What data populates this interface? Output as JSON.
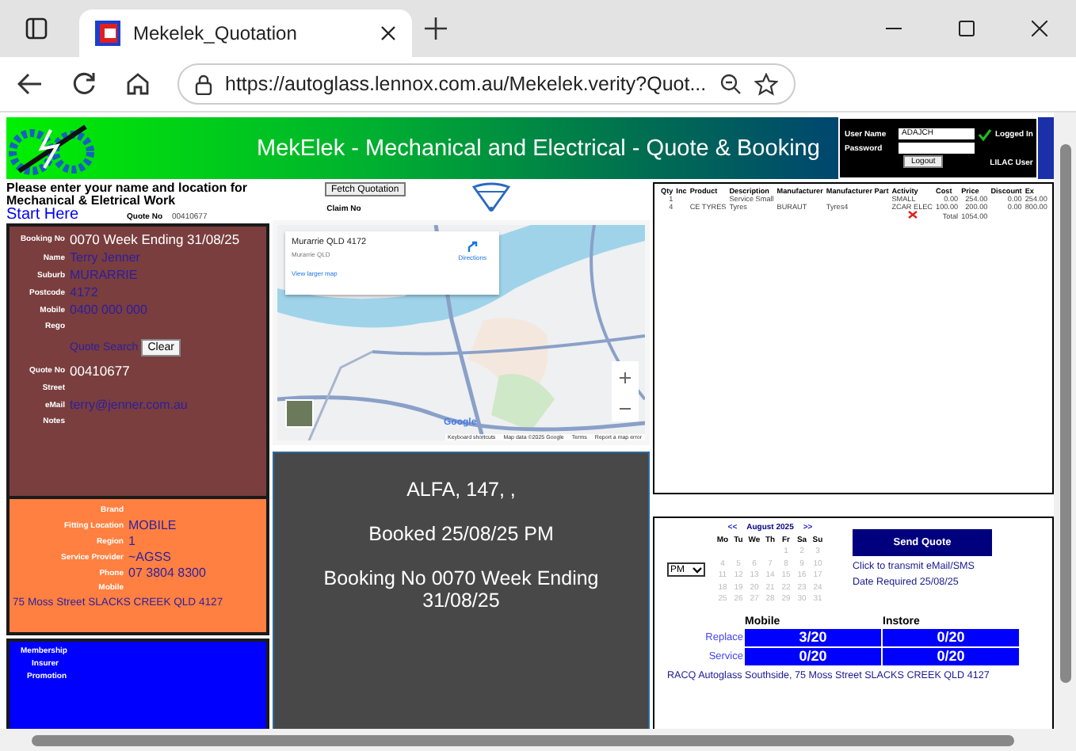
{
  "browser": {
    "tab_title": "Mekelek_Quotation",
    "url": "https://autoglass.lennox.com.au/Mekelek.verity?Quot..."
  },
  "header": {
    "title": "MekElek - Mechanical and Electrical - Quote & Booking",
    "login": {
      "user_label": "User Name",
      "user_value": "ADAJCH",
      "password_label": "Password",
      "logout": "Logout",
      "status": "Logged In",
      "role": "LILAC User"
    }
  },
  "intro": {
    "text": "Please enter your name and location for Mechanical & Eletrical Work",
    "start_link": "Start Here",
    "quote_label": "Quote No",
    "quote_value": "00410677"
  },
  "booking_fields": [
    {
      "kind": "heading",
      "label": "Booking No",
      "value": "0070 Week Ending 31/08/25"
    },
    {
      "kind": "field",
      "label": "Name",
      "value": "Terry Jenner"
    },
    {
      "kind": "field",
      "label": "Suburb",
      "value": "MURARRIE"
    },
    {
      "kind": "field",
      "label": "Postcode",
      "value": "4172"
    },
    {
      "kind": "field",
      "label": "Mobile",
      "value": "0400 000 000"
    },
    {
      "kind": "field",
      "label": "Rego"
    },
    {
      "kind": "search",
      "link": "Quote Search",
      "button": "Clear"
    },
    {
      "kind": "heading",
      "label": "Quote No",
      "value": "00410677"
    },
    {
      "kind": "field",
      "label": "Street"
    },
    {
      "kind": "field",
      "label": "eMail",
      "value": "terry@jenner.com.au"
    },
    {
      "kind": "field",
      "label": "Notes"
    }
  ],
  "provider_fields": [
    {
      "label": "Brand"
    },
    {
      "label": "Fitting Location",
      "value": "MOBILE"
    },
    {
      "label": "Region",
      "value": "1"
    },
    {
      "label": "Service Provider",
      "value": "~AGSS"
    },
    {
      "label": "Phone",
      "value": "07 3804 8300"
    },
    {
      "label": "Mobile"
    }
  ],
  "provider_address": "75 Moss Street SLACKS CREEK QLD 4127",
  "extra_fields": [
    "Membership",
    "Insurer",
    "Promotion"
  ],
  "fetch_button": "Fetch Quotation",
  "claim_label": "Claim No",
  "map": {
    "place": "Murarrie QLD 4172",
    "subtitle": "Murarrie QLD",
    "directions": "Directions",
    "larger": "View larger map",
    "logo": "Google",
    "footer": [
      "Keyboard shortcuts",
      "Map data ©2025 Google",
      "Terms",
      "Report a map error"
    ]
  },
  "summary": [
    "ALFA, 147, ,",
    "Booked 25/08/25 PM",
    "Booking No 0070 Week Ending 31/08/25"
  ],
  "quote_table": {
    "columns": [
      {
        "kind": "number",
        "label": "Qty"
      },
      {
        "kind": "text",
        "label": "Inc"
      },
      {
        "kind": "text",
        "label": "Product"
      },
      {
        "kind": "text",
        "label": "Description"
      },
      {
        "kind": "text",
        "label": "Manufacturer"
      },
      {
        "kind": "text",
        "label": "Manufacturer Part"
      },
      {
        "kind": "text",
        "label": "Activity"
      },
      {
        "kind": "number",
        "label": "Cost"
      },
      {
        "kind": "number",
        "label": "Price"
      },
      {
        "kind": "number",
        "label": "Discount"
      },
      {
        "kind": "number",
        "label": "Ex"
      }
    ],
    "rows": [
      [
        "1",
        null,
        null,
        "Service Small",
        null,
        null,
        "SMALL",
        "0.00",
        "254.00",
        "0.00",
        "254.00"
      ],
      [
        "4",
        null,
        "CE TYRES",
        "Tyres",
        "BURAUT",
        "Tyres4",
        "ZCAR ELEC",
        "100.00",
        "200.00",
        "0.00",
        "800.00"
      ]
    ],
    "total_label": "Total",
    "total_value": "1054.00"
  },
  "calendar": {
    "prev": "<<",
    "month": "August 2025",
    "next": ">>",
    "weekdays": [
      "Mo",
      "Tu",
      "We",
      "Th",
      "Fr",
      "Sa",
      "Su"
    ],
    "weeks": [
      [
        "1",
        "2",
        "3"
      ],
      [
        "4",
        "5",
        "6",
        "7",
        "8",
        "9",
        "10"
      ],
      [
        "11",
        "12",
        "13",
        "14",
        "15",
        "16",
        "17"
      ],
      [
        "18",
        "19",
        "20",
        "21",
        "22",
        "23",
        "24"
      ],
      [
        "25",
        "26",
        "27",
        "28",
        "29",
        "30",
        "31"
      ]
    ]
  },
  "time_select": {
    "value": "PM"
  },
  "send_button": "Send Quote",
  "transmit_text": "Click to transmit eMail/SMS",
  "date_required": "Date Required 25/08/25",
  "capacity": {
    "columns": [
      "Mobile",
      "Instore"
    ],
    "rows": [
      {
        "label": "Replace",
        "values": [
          "3/20",
          "0/20"
        ]
      },
      {
        "label": "Service",
        "values": [
          "0/20",
          "0/20"
        ]
      }
    ]
  },
  "branch_address": "RACQ Autoglass Southside, 75 Moss Street SLACKS CREEK QLD 4127"
}
